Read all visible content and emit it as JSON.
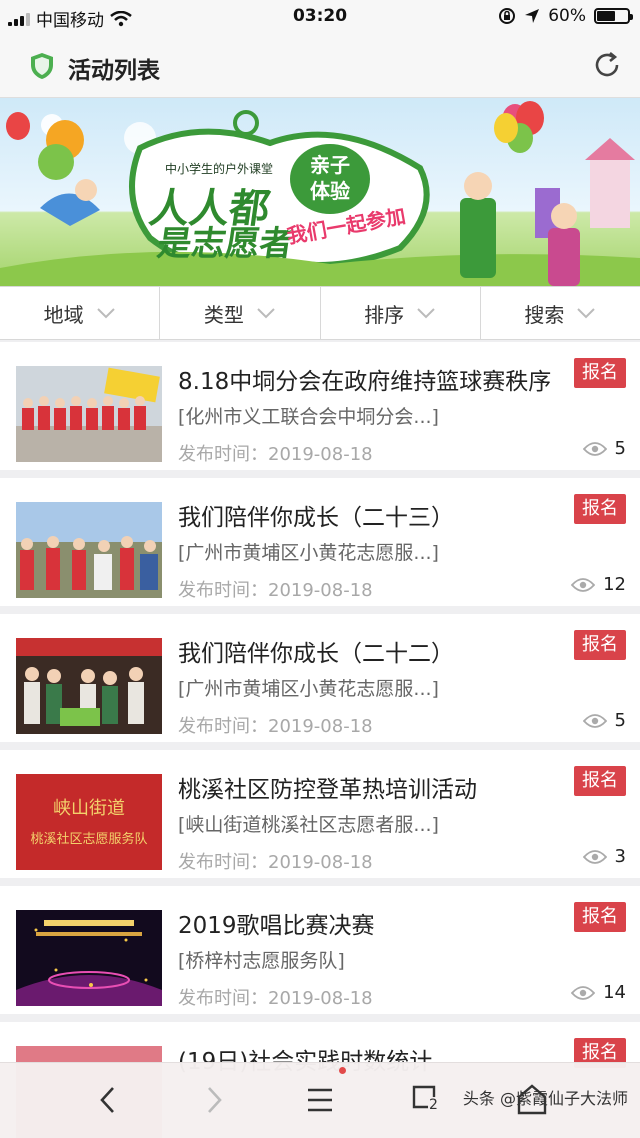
{
  "status_bar": {
    "carrier": "中国移动",
    "time": "03:20",
    "battery": "60%",
    "battery_level": 0.6
  },
  "header": {
    "title": "活动列表",
    "icons": [
      "shield-icon",
      "refresh-icon"
    ]
  },
  "banner": {
    "subtitle": "中小学生的户外课堂",
    "line1": "人人都",
    "line2": "是志愿者",
    "badge_line1": "亲子",
    "badge_line2": "体验",
    "slogan": "我们一起参加"
  },
  "filters": [
    {
      "label": "地域"
    },
    {
      "label": "类型"
    },
    {
      "label": "排序"
    },
    {
      "label": "搜索"
    }
  ],
  "activities": [
    {
      "title": "8.18中垌分会在政府维持篮球赛秩序",
      "org": "[化州市义工联合会中垌分会...]",
      "date": "发布时间：2019-08-18",
      "views": "5",
      "signup": "报名"
    },
    {
      "title": "我们陪伴你成长（二十三）",
      "org": "[广州市黄埔区小黄花志愿服...]",
      "date": "发布时间：2019-08-18",
      "views": "12",
      "signup": "报名"
    },
    {
      "title": "我们陪伴你成长（二十二）",
      "org": "[广州市黄埔区小黄花志愿服...]",
      "date": "发布时间：2019-08-18",
      "views": "5",
      "signup": "报名"
    },
    {
      "title": "桃溪社区防控登革热培训活动",
      "org": "[峡山街道桃溪社区志愿者服...]",
      "date": "发布时间：2019-08-18",
      "views": "3",
      "signup": "报名"
    },
    {
      "title": "2019歌唱比赛决赛",
      "org": "[桥梓村志愿服务队]",
      "date": "发布时间：2019-08-18",
      "views": "14",
      "signup": "报名"
    },
    {
      "title": "(19日)社会实践时数统计",
      "org": "",
      "date": "",
      "views": "",
      "signup": "报名"
    }
  ],
  "thumb_text": {
    "sign_line1": "峡山街道",
    "sign_line2": "桃溪社区志愿服务队"
  },
  "bottom_nav": {
    "tabs_count": "2",
    "watermark": "头条 @紫霞仙子大法师"
  },
  "colors": {
    "accent_red": "#d9434a",
    "brand_green": "#3c9a3a"
  }
}
